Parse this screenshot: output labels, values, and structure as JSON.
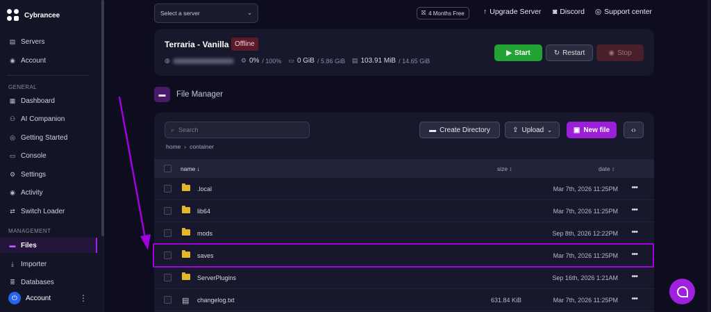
{
  "brand": {
    "name": "Cybrancee"
  },
  "sidebar": {
    "top_items": [
      {
        "label": "Servers",
        "icon": "server-icon"
      },
      {
        "label": "Account",
        "icon": "account-icon"
      }
    ],
    "section_general": "GENERAL",
    "general_items": [
      {
        "label": "Dashboard",
        "icon": "dashboard-icon"
      },
      {
        "label": "AI Companion",
        "icon": "ai-icon"
      },
      {
        "label": "Getting Started",
        "icon": "globe-icon"
      },
      {
        "label": "Console",
        "icon": "console-icon"
      },
      {
        "label": "Settings",
        "icon": "gear-icon"
      },
      {
        "label": "Activity",
        "icon": "eye-icon"
      },
      {
        "label": "Switch Loader",
        "icon": "switch-icon"
      }
    ],
    "section_management": "MANAGEMENT",
    "management_items": [
      {
        "label": "Files",
        "icon": "folder-icon",
        "active": true
      },
      {
        "label": "Importer",
        "icon": "download-icon"
      },
      {
        "label": "Databases",
        "icon": "database-icon"
      }
    ],
    "footer": {
      "label": "Account"
    }
  },
  "topbar": {
    "server_select_placeholder": "Select a server",
    "months_free": "4 Months Free",
    "upgrade": "Upgrade Server",
    "discord": "Discord",
    "support": "Support center"
  },
  "server": {
    "name": "Terraria - Vanilla",
    "status": "Offline",
    "cpu": "0%",
    "cpu_limit": "/ 100%",
    "memory": "0 GiB",
    "memory_limit": "/ 5.86 GiB",
    "disk": "103.91 MiB",
    "disk_limit": "/ 14.65 GiB",
    "buttons": {
      "start": "Start",
      "restart": "Restart",
      "stop": "Stop"
    }
  },
  "file_manager": {
    "title": "File Manager",
    "search_placeholder": "Search",
    "breadcrumb": [
      "home",
      "container"
    ],
    "buttons": {
      "create_directory": "Create Directory",
      "upload": "Upload",
      "new_file": "New file"
    },
    "columns": {
      "name": "name ↓",
      "size": "size ↕",
      "date": "date ↕"
    },
    "rows": [
      {
        "name": ".local",
        "type": "folder",
        "size": "",
        "date": "Mar 7th, 2026 11:25PM"
      },
      {
        "name": "lib64",
        "type": "folder",
        "size": "",
        "date": "Mar 7th, 2026 11:25PM"
      },
      {
        "name": "mods",
        "type": "folder",
        "size": "",
        "date": "Sep 8th, 2026 12:22PM"
      },
      {
        "name": "saves",
        "type": "folder",
        "size": "",
        "date": "Mar 7th, 2026 11:25PM",
        "highlighted": true
      },
      {
        "name": "ServerPlugins",
        "type": "folder",
        "size": "",
        "date": "Sep 16th, 2026 1:21AM"
      },
      {
        "name": "changelog.txt",
        "type": "file",
        "size": "631.84 KiB",
        "date": "Mar 7th, 2026 11:25PM"
      }
    ]
  },
  "colors": {
    "accent": "#a020f0",
    "start": "#22a334",
    "stop": "#4a1f2a",
    "offline_badge": "#5a1a28",
    "folder": "#e6b828"
  }
}
